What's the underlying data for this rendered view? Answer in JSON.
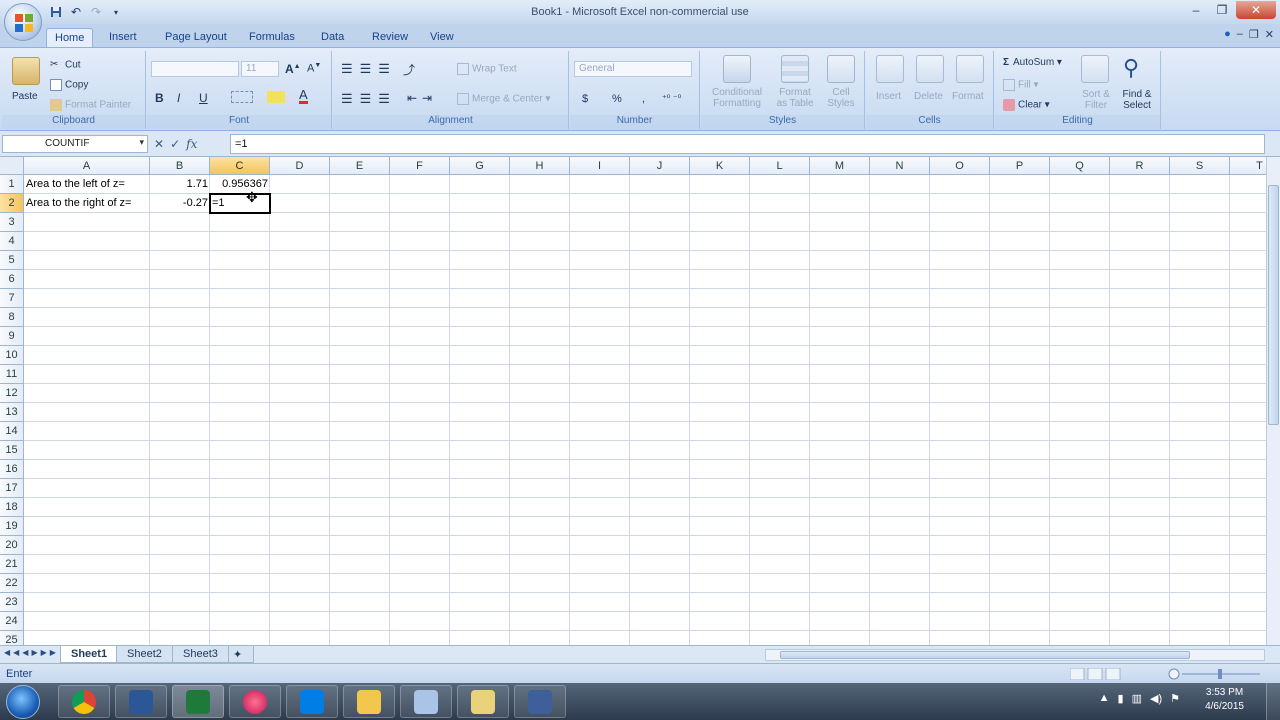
{
  "window": {
    "title": "Book1 - Microsoft Excel non-commercial use"
  },
  "qat": {
    "save_icon": "save-icon",
    "undo_icon": "undo-icon",
    "redo_icon": "redo-icon"
  },
  "ribbon_tabs": [
    "Home",
    "Insert",
    "Page Layout",
    "Formulas",
    "Data",
    "Review",
    "View"
  ],
  "active_tab": "Home",
  "clipboard": {
    "paste": "Paste",
    "cut": "Cut",
    "copy": "Copy",
    "format_painter": "Format Painter",
    "label": "Clipboard"
  },
  "font": {
    "font_size": "11",
    "bold": "B",
    "italic": "I",
    "underline": "U",
    "label": "Font"
  },
  "alignment": {
    "wrap_text": "Wrap Text",
    "merge_center": "Merge & Center",
    "label": "Alignment"
  },
  "number": {
    "format": "General",
    "currency": "$",
    "percent": "%",
    "comma": ",",
    "label": "Number"
  },
  "styles": {
    "conditional_formatting_1": "Conditional",
    "conditional_formatting_2": "Formatting",
    "format_table_1": "Format",
    "format_table_2": "as Table",
    "cell_styles_1": "Cell",
    "cell_styles_2": "Styles",
    "label": "Styles"
  },
  "cells": {
    "insert": "Insert",
    "delete": "Delete",
    "format": "Format",
    "label": "Cells"
  },
  "editing": {
    "autosum": "AutoSum",
    "fill": "Fill",
    "clear": "Clear",
    "sort_1": "Sort &",
    "sort_2": "Filter",
    "find_1": "Find &",
    "find_2": "Select",
    "label": "Editing"
  },
  "formula_bar": {
    "name_box": "COUNTIF",
    "formula": "=1",
    "fx": "fx",
    "cancel": "✕",
    "enter": "✓"
  },
  "columns": [
    "A",
    "B",
    "C",
    "D",
    "E",
    "F",
    "G",
    "H",
    "I",
    "J",
    "K",
    "L",
    "M",
    "N",
    "O",
    "P",
    "Q",
    "R",
    "S",
    "T"
  ],
  "rows": [
    "1",
    "2",
    "3",
    "4",
    "5",
    "6",
    "7",
    "8",
    "9",
    "10",
    "11",
    "12",
    "13",
    "14",
    "15",
    "16",
    "17",
    "18",
    "19",
    "20",
    "21",
    "22",
    "23",
    "24",
    "25"
  ],
  "cells_data": {
    "a1": "Area to the left of z=",
    "b1": "1.71",
    "c1": "0.956367",
    "a2": "Area to the right of z=",
    "b2": "-0.27",
    "c2": "=1"
  },
  "sheets": [
    "Sheet1",
    "Sheet2",
    "Sheet3"
  ],
  "active_sheet": "Sheet1",
  "status": {
    "mode": "Enter"
  },
  "taskbar": {
    "time": "3:53 PM",
    "date": "4/6/2015"
  },
  "colors": {
    "accent": "#15428b",
    "selected_header": "#f5c35b",
    "excel_green": "#1d7a3a"
  }
}
